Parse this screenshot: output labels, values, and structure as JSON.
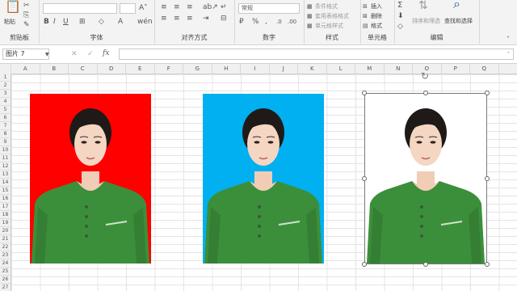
{
  "ribbon": {
    "clipboard": {
      "label": "剪贴板",
      "paste_label": "粘贴"
    },
    "font": {
      "label": "字体",
      "font_name": "",
      "font_size": ""
    },
    "alignment": {
      "label": "对齐方式"
    },
    "number": {
      "label": "数字",
      "format_value": "常规"
    },
    "styles": {
      "label": "样式",
      "conditional_format": "条件格式",
      "format_as_table": "套用表格格式",
      "cell_styles": "单元格样式"
    },
    "cells": {
      "label": "单元格",
      "insert": "插入",
      "delete": "删除",
      "format": "格式"
    },
    "editing": {
      "label": "编辑",
      "sort_filter": "排序和筛选",
      "find_select": "查找和选择"
    }
  },
  "formula_bar": {
    "name_box": "图片 7",
    "fx": "fx",
    "content": ""
  },
  "columns": [
    "A",
    "B",
    "C",
    "D",
    "E",
    "F",
    "G",
    "H",
    "I",
    "J",
    "K",
    "L",
    "M",
    "N",
    "O",
    "P",
    "Q"
  ],
  "rows": [
    "1",
    "2",
    "3",
    "4",
    "5",
    "6",
    "7",
    "8",
    "9",
    "10",
    "11",
    "12",
    "13",
    "14",
    "15",
    "16",
    "17",
    "18",
    "19",
    "20",
    "21",
    "22",
    "23",
    "24",
    "25",
    "26",
    "27"
  ],
  "photos": [
    {
      "background": "#ff0000",
      "shirt": "#3c8f3a"
    },
    {
      "background": "#00b0f0",
      "shirt": "#3c8f3a"
    },
    {
      "background": "#ffffff",
      "shirt": "#3c8f3a",
      "selected": true
    }
  ],
  "colors": {
    "ribbon_bg": "#f3f3f3",
    "grid": "#e4e4e4",
    "header_bg": "#f0f0f0"
  }
}
